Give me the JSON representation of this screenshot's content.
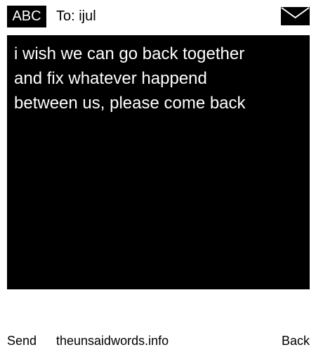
{
  "header": {
    "input_mode": "ABC",
    "recipient": "To: ijul",
    "icon": "envelope-icon"
  },
  "message": {
    "text": "i wish we can go back together\nand fix whatever happend\nbetween us, please come back"
  },
  "footer": {
    "send_label": "Send",
    "site": "theunsaidwords.info",
    "back_label": "Back"
  },
  "colors": {
    "background": "#ffffff",
    "message_bg": "#000000",
    "message_text": "#ffffff",
    "text": "#000000"
  }
}
